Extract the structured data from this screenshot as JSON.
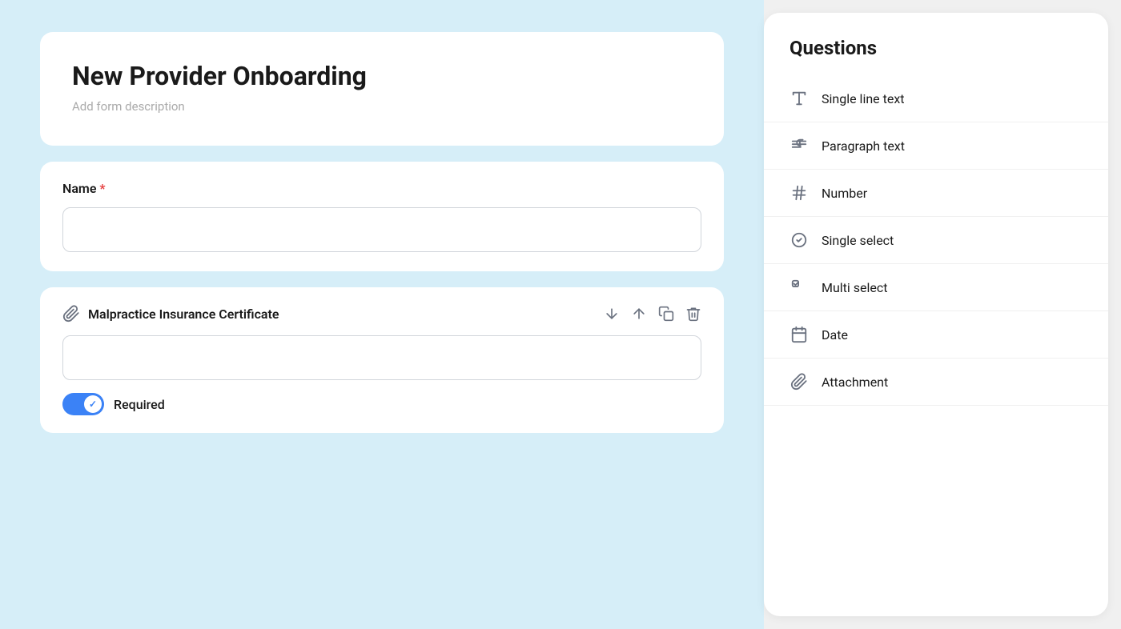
{
  "left": {
    "form_title": "New Provider Onboarding",
    "form_description": "Add form description",
    "name_field": {
      "label": "Name",
      "required": true,
      "placeholder": ""
    },
    "attachment_field": {
      "title": "Malpractice Insurance Certificate",
      "required_label": "Required",
      "toggle_on": true
    }
  },
  "right": {
    "panel_title": "Questions",
    "items": [
      {
        "id": "single-line-text",
        "label": "Single line text",
        "icon": "text-icon"
      },
      {
        "id": "paragraph-text",
        "label": "Paragraph text",
        "icon": "paragraph-icon"
      },
      {
        "id": "number",
        "label": "Number",
        "icon": "number-icon"
      },
      {
        "id": "single-select",
        "label": "Single select",
        "icon": "single-select-icon"
      },
      {
        "id": "multi-select",
        "label": "Multi select",
        "icon": "multi-select-icon"
      },
      {
        "id": "date",
        "label": "Date",
        "icon": "date-icon"
      },
      {
        "id": "attachment",
        "label": "Attachment",
        "icon": "attachment-icon"
      }
    ]
  }
}
